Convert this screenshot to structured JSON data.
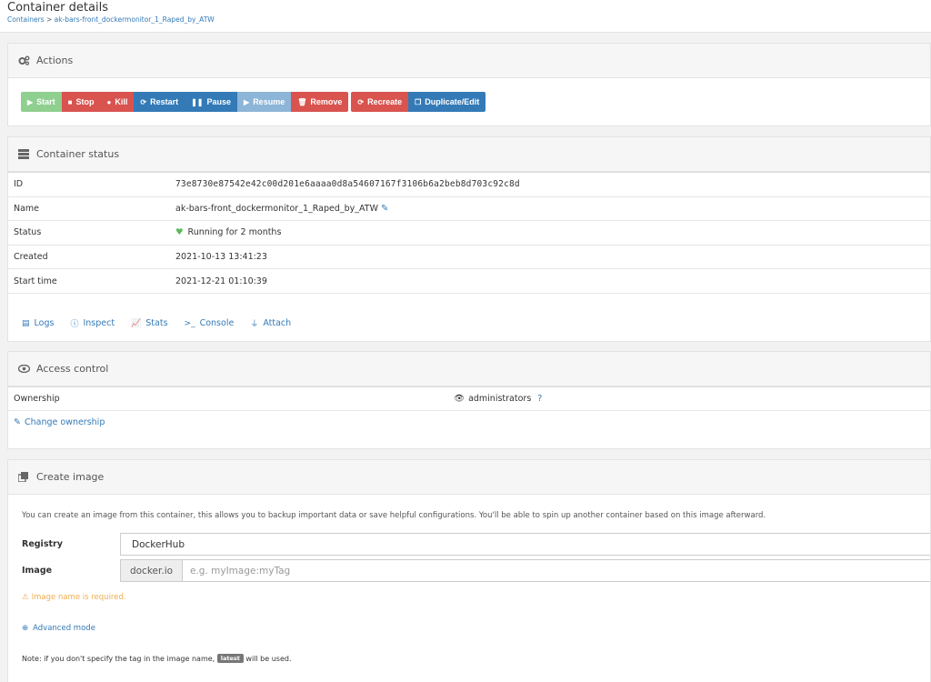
{
  "page": {
    "title": "Container details",
    "breadcrumb": {
      "root": "Containers",
      "sep": ">",
      "current": "ak-bars-front_dockermonitor_1_Raped_by_ATW"
    }
  },
  "actions": {
    "title": "Actions",
    "buttons": {
      "start": "Start",
      "stop": "Stop",
      "kill": "Kill",
      "restart": "Restart",
      "pause": "Pause",
      "resume": "Resume",
      "remove": "Remove",
      "recreate": "Recreate",
      "duplicate": "Duplicate/Edit"
    }
  },
  "status": {
    "title": "Container status",
    "rows": [
      {
        "key": "ID",
        "value": "73e8730e87542e42c00d201e6aaaa0d8a54607167f3106b6a2beb8d703c92c8d"
      },
      {
        "key": "Name",
        "value": "ak-bars-front_dockermonitor_1_Raped_by_ATW"
      },
      {
        "key": "Status",
        "value": "Running for 2 months"
      },
      {
        "key": "Created",
        "value": "2021-10-13 13:41:23"
      },
      {
        "key": "Start time",
        "value": "2021-12-21 01:10:39"
      }
    ],
    "links": {
      "logs": "Logs",
      "inspect": "Inspect",
      "stats": "Stats",
      "console": "Console",
      "attach": "Attach"
    }
  },
  "access": {
    "title": "Access control",
    "ownership_label": "Ownership",
    "ownership_value": "administrators",
    "change_link": "Change ownership"
  },
  "create_image": {
    "title": "Create image",
    "help": "You can create an image from this container, this allows you to backup important data or save helpful configurations. You'll be able to spin up another container based on this image afterward.",
    "registry_label": "Registry",
    "registry_value": "DockerHub",
    "image_label": "Image",
    "image_prefix": "docker.io",
    "image_placeholder": "e.g. myImage:myTag",
    "warning": "Image name is required.",
    "advanced_link": "Advanced mode",
    "note_before": "Note: if you don't specify the tag in the image name,",
    "note_badge": "latest",
    "note_after": "will be used."
  },
  "colors": {
    "link": "#337ab7",
    "danger": "#d9534f",
    "success": "#8fcf8f",
    "warning": "#f0ad4e",
    "running": "#5cb85c"
  }
}
